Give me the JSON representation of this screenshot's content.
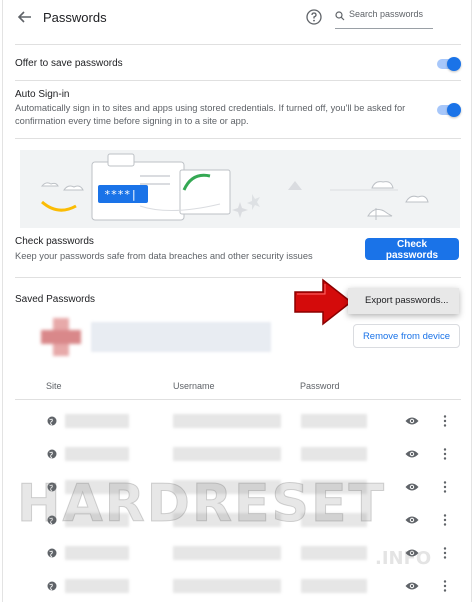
{
  "header": {
    "title": "Passwords",
    "search_placeholder": "Search passwords"
  },
  "offer_to_save": {
    "label": "Offer to save passwords",
    "enabled": true
  },
  "auto_sign_in": {
    "label": "Auto Sign-in",
    "description": "Automatically sign in to sites and apps using stored credentials. If turned off, you'll be asked for confirmation every time before signing in to a site or app.",
    "enabled": true
  },
  "banner": {
    "password_mask": "****|"
  },
  "check_passwords": {
    "title": "Check passwords",
    "description": "Keep your passwords safe from data breaches and other security issues",
    "button_label": "Check passwords"
  },
  "saved_passwords": {
    "title": "Saved Passwords",
    "menu_item_label": "Export passwords...",
    "remove_button_label": "Remove from device",
    "columns": [
      "Site",
      "Username",
      "Password"
    ],
    "row_count": 6
  },
  "watermark": {
    "text": "HARDRESET",
    "suffix": ".INFO"
  },
  "colors": {
    "accent": "#1a73e8",
    "arrow": "#d40b0b"
  },
  "icons": [
    "back-arrow-icon",
    "help-icon",
    "search-icon",
    "globe-icon",
    "eye-icon",
    "more-vert-icon",
    "red-arrow-icon"
  ]
}
